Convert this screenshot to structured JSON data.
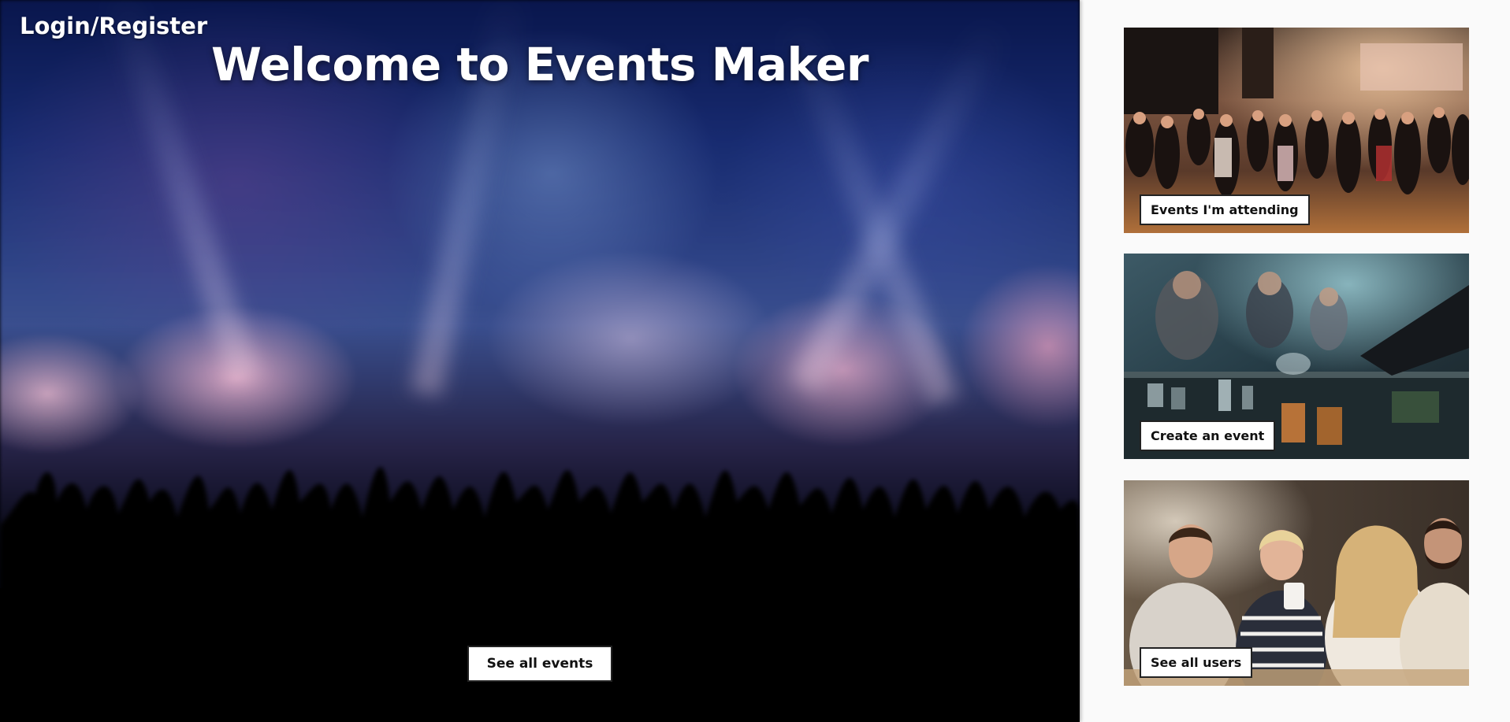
{
  "hero": {
    "login_link": "Login/Register",
    "title": "Welcome to Events Maker",
    "see_events_button": "See all events"
  },
  "cards": [
    {
      "label": "Events I'm attending",
      "image": "crowd-at-indoor-event-photo"
    },
    {
      "label": "Create an event",
      "image": "bartender-pouring-drinks-photo"
    },
    {
      "label": "See all users",
      "image": "friends-at-cafe-photo"
    }
  ],
  "colors": {
    "page_background": "#fafafa",
    "button_background": "#ffffff",
    "button_border": "#222222",
    "title_text": "#ffffff"
  }
}
